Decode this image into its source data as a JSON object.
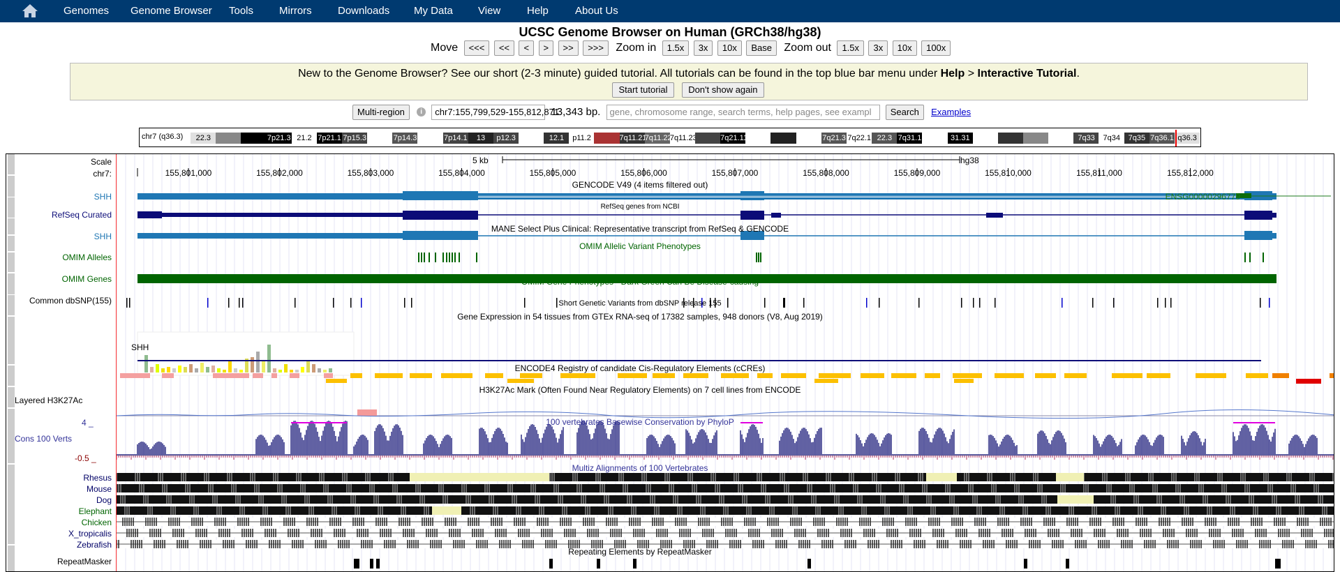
{
  "nav": {
    "items": [
      "Genomes",
      "Genome Browser",
      "Tools",
      "Mirrors",
      "Downloads",
      "My Data",
      "View",
      "Help",
      "About Us"
    ]
  },
  "title": "UCSC Genome Browser on Human (GRCh38/hg38)",
  "controls": {
    "move_label": "Move",
    "move_buttons": [
      "<<<",
      "<<",
      "<",
      ">",
      ">>",
      ">>>"
    ],
    "zoomin_label": "Zoom in",
    "zoomin_buttons": [
      "1.5x",
      "3x",
      "10x",
      "Base"
    ],
    "zoomout_label": "Zoom out",
    "zoomout_buttons": [
      "1.5x",
      "3x",
      "10x",
      "100x"
    ]
  },
  "tutorial": {
    "msg_pre": "New to the Genome Browser? See our short (2-3 minute) guided tutorial. All tutorials can be found in the top blue bar menu under ",
    "msg_help": "Help",
    "msg_gt": " > ",
    "msg_it": "Interactive Tutorial",
    "msg_dot": ".",
    "start": "Start tutorial",
    "dismiss": "Don't show again"
  },
  "position": {
    "multiregion": "Multi-region",
    "info": "i",
    "position": "chr7:155,799,529-155,812,871",
    "size": "13,343 bp.",
    "search_placeholder": "gene, chromosome range, search terms, help pages, see exampl",
    "search_btn": "Search",
    "examples": "Examples"
  },
  "ideogram": {
    "chr_label": "chr7 (q36.3)",
    "bands": [
      {
        "name": "22.3",
        "color": "#e0e0e0"
      },
      {
        "name": "",
        "color": "#888"
      },
      {
        "name": "",
        "color": "#000"
      },
      {
        "name": "7p21.3",
        "color": "#000"
      },
      {
        "name": "21.2",
        "color": "#fff"
      },
      {
        "name": "7p21.1",
        "color": "#000"
      },
      {
        "name": "7p15.3",
        "color": "#444"
      },
      {
        "name": "",
        "color": "#fff"
      },
      {
        "name": "7p14.3",
        "color": "#555"
      },
      {
        "name": "",
        "color": "#fff"
      },
      {
        "name": "7p14.1",
        "color": "#444"
      },
      {
        "name": "13",
        "color": "#222"
      },
      {
        "name": "p12.3",
        "color": "#444"
      },
      {
        "name": "",
        "color": "#fff"
      },
      {
        "name": "12.1",
        "color": "#333"
      },
      {
        "name": "p11.2",
        "color": "#fff"
      },
      {
        "name": "",
        "color": "#a33"
      },
      {
        "name": "7q11.21",
        "color": "#333"
      },
      {
        "name": "7q11.22",
        "color": "#666"
      },
      {
        "name": "7q11.23",
        "color": "#fff"
      },
      {
        "name": "",
        "color": "#444"
      },
      {
        "name": "7q21.11",
        "color": "#000"
      },
      {
        "name": "",
        "color": "#fff"
      },
      {
        "name": "",
        "color": "#222"
      },
      {
        "name": "",
        "color": "#fff"
      },
      {
        "name": "7q21.3",
        "color": "#555"
      },
      {
        "name": "7q22.1",
        "color": "#fff"
      },
      {
        "name": "22.3",
        "color": "#555"
      },
      {
        "name": "7q31.1",
        "color": "#000"
      },
      {
        "name": "",
        "color": "#fff"
      },
      {
        "name": "31.31",
        "color": "#000"
      },
      {
        "name": "",
        "color": "#fff"
      },
      {
        "name": "",
        "color": "#333"
      },
      {
        "name": "",
        "color": "#888"
      },
      {
        "name": "",
        "color": "#fff"
      },
      {
        "name": "7q33",
        "color": "#444"
      },
      {
        "name": "7q34",
        "color": "#fff"
      },
      {
        "name": "7q35",
        "color": "#333"
      },
      {
        "name": "7q36.1",
        "color": "#555"
      },
      {
        "name": "q36.3",
        "color": "#e0e0e0"
      }
    ]
  },
  "tracks": {
    "scale": {
      "label": "Scale",
      "chr": "chr7:",
      "kb": "5 kb",
      "assembly": "hg38",
      "ticks": [
        "155,801,000",
        "155,802,000",
        "155,803,000",
        "155,804,000",
        "155,805,000",
        "155,806,000",
        "155,807,000",
        "155,808,000",
        "155,809,000",
        "155,810,000",
        "155,811,000",
        "155,812,000"
      ]
    },
    "gencode": {
      "title": "GENCODE V49 (4 items filtered out)",
      "gene": "SHH",
      "gene2": "ENSG00000296779"
    },
    "refseq": {
      "label": "RefSeq Curated",
      "title": "RefSeq genes from NCBI"
    },
    "mane": {
      "title": "MANE Select Plus Clinical: Representative transcript from RefSeq & GENCODE",
      "gene": "SHH"
    },
    "omim_alleles": {
      "label": "OMIM Alleles",
      "title": "OMIM Allelic Variant Phenotypes"
    },
    "omim_genes": {
      "label": "OMIM Genes",
      "title": "OMIM Gene Phenotypes - Dark Green Can Be Disease-causing"
    },
    "dbsnp": {
      "label": "Common dbSNP(155)",
      "title": "Short Genetic Variants from dbSNP release 155"
    },
    "gtex": {
      "title": "Gene Expression in 54 tissues from GTEx RNA-seq of 17382 samples, 948 donors (V8, Aug 2019)",
      "gene": "SHH"
    },
    "encode": {
      "title": "ENCODE4 Registry of candidate Cis-Regulatory Elements (cCREs)"
    },
    "h3k27ac": {
      "label": "Layered H3K27Ac",
      "title": "H3K27Ac Mark (Often Found Near Regulatory Elements) on 7 cell lines from ENCODE"
    },
    "cons": {
      "label": "Cons 100 Verts",
      "max": "4 _",
      "min": "-0.5 _",
      "title": "100 vertebrates Basewise Conservation by PhyloP"
    },
    "multiz": {
      "title": "Multiz Alignments of 100 Vertebrates",
      "species": [
        "Rhesus",
        "Mouse",
        "Dog",
        "Elephant",
        "Chicken",
        "X_tropicalis",
        "Zebrafish"
      ]
    },
    "repeat": {
      "label": "RepeatMasker",
      "title": "Repeating Elements by RepeatMasker"
    }
  },
  "colors": {
    "topbar": "#003a70",
    "gencode": "#1f77b4",
    "refseq": "#0c0c78",
    "omim": "#006400",
    "cons": "#3a3a8c",
    "cons_label": "#333399"
  }
}
